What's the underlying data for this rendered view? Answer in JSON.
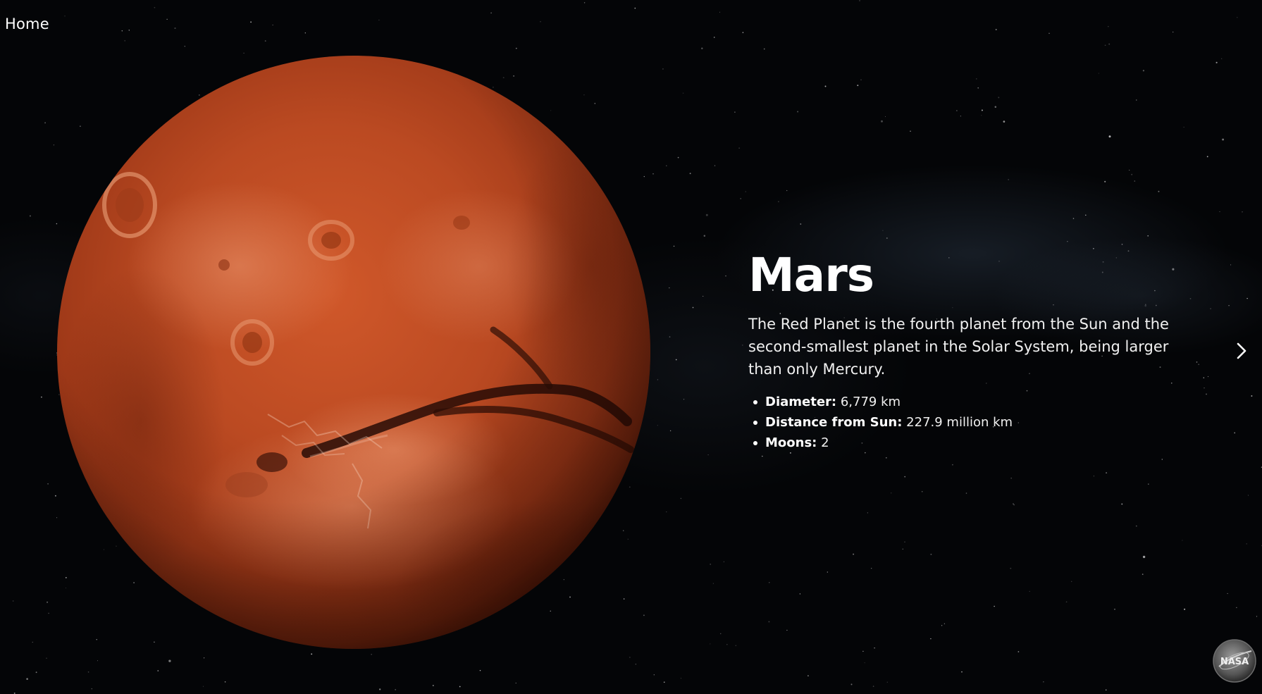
{
  "nav": {
    "home_label": "Home"
  },
  "planet": {
    "name": "Mars",
    "description": "The Red Planet is the fourth planet from the Sun and the second-smallest planet in the Solar System, being larger than only Mercury.",
    "facts": [
      {
        "label": "Diameter:",
        "value": "6,779 km"
      },
      {
        "label": "Distance from Sun:",
        "value": "227.9 million km"
      },
      {
        "label": "Moons:",
        "value": "2"
      }
    ]
  },
  "controls": {
    "next_icon": "chevron-right-icon"
  },
  "badge": {
    "logo_text": "NASA",
    "icon": "nasa-logo"
  },
  "colors": {
    "background": "#040507",
    "planet_base": "#b8431f",
    "text": "#ffffff"
  }
}
